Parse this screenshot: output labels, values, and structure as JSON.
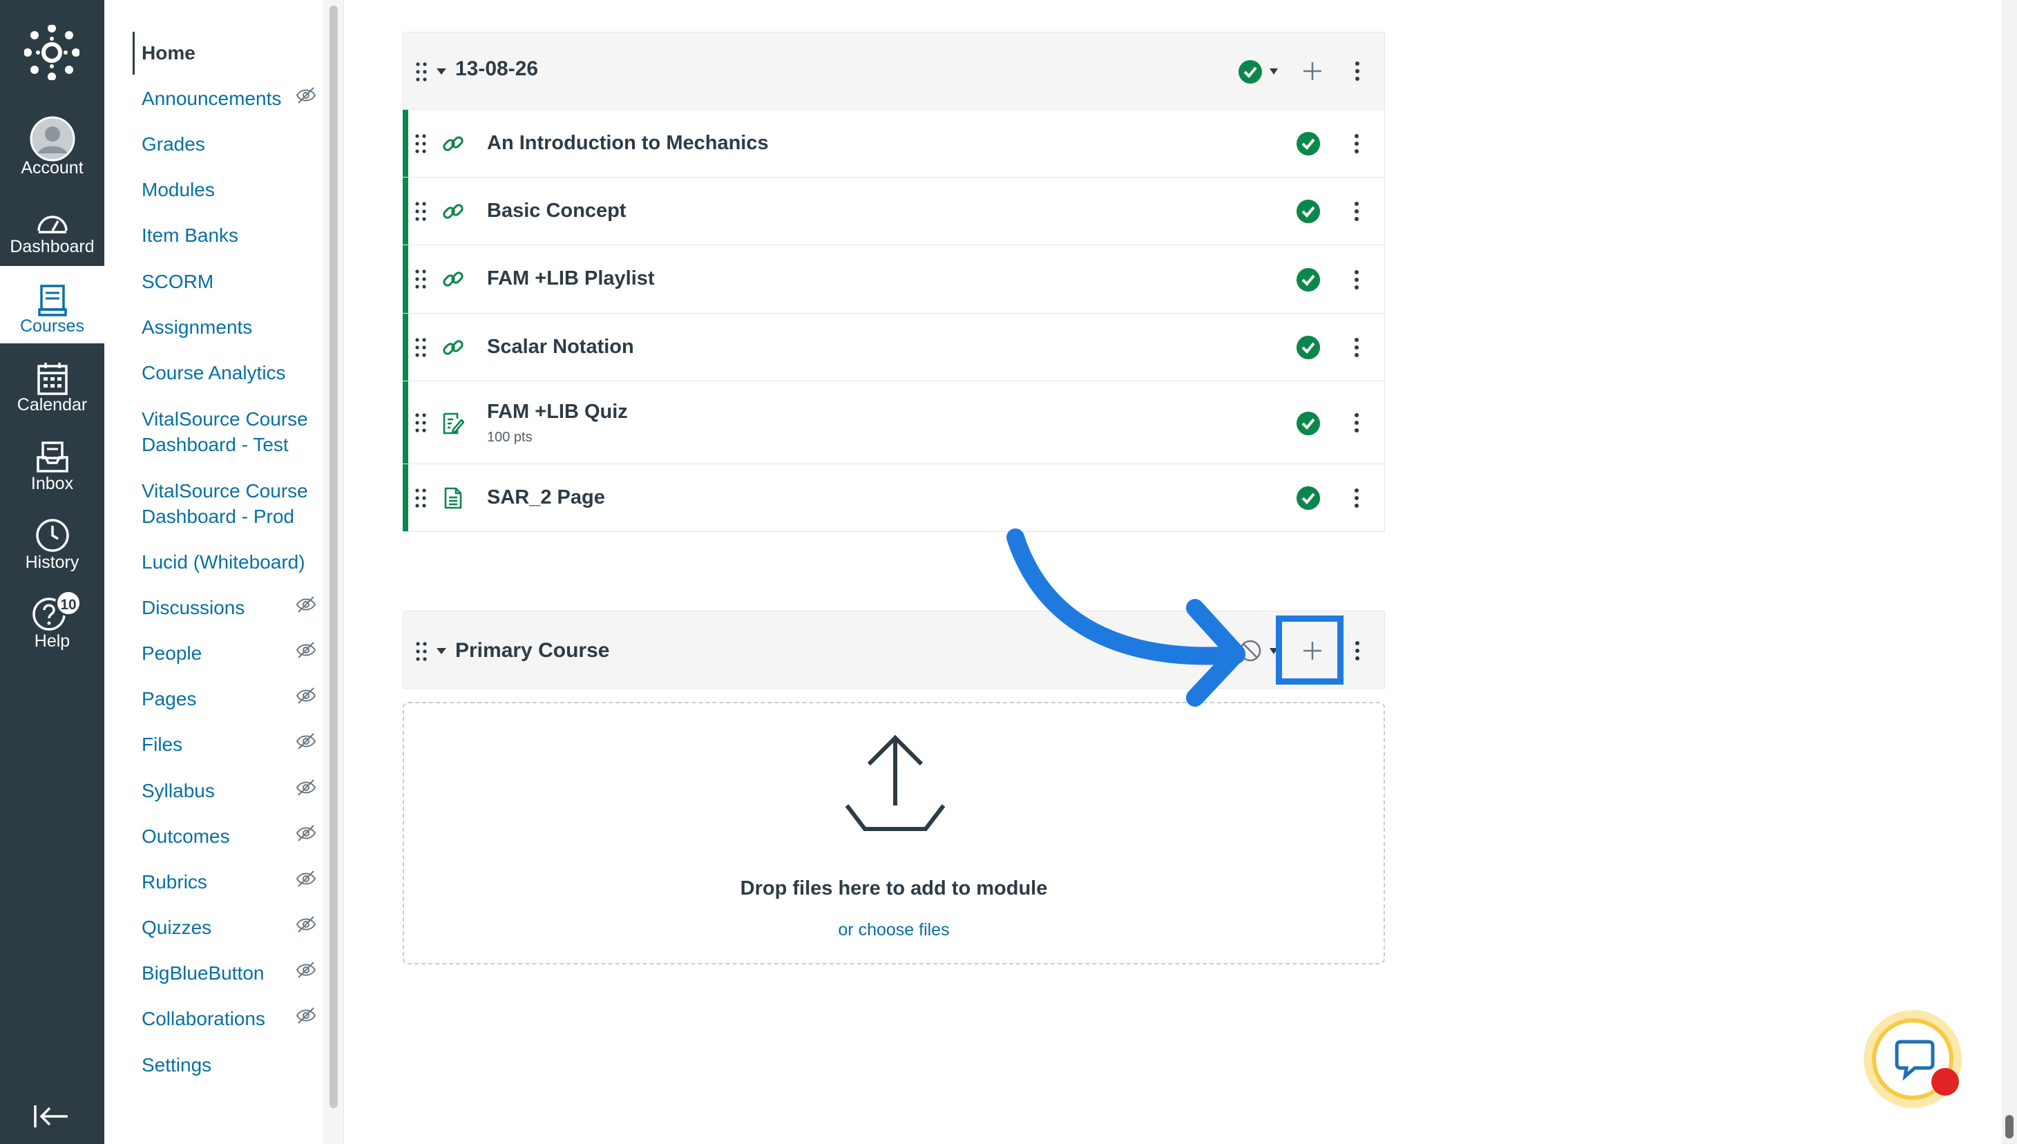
{
  "global_nav": {
    "items": [
      {
        "label": "Account",
        "icon": "account-avatar-icon"
      },
      {
        "label": "Dashboard",
        "icon": "dashboard-icon"
      },
      {
        "label": "Courses",
        "icon": "courses-icon"
      },
      {
        "label": "Calendar",
        "icon": "calendar-icon"
      },
      {
        "label": "Inbox",
        "icon": "inbox-icon"
      },
      {
        "label": "History",
        "icon": "history-icon"
      },
      {
        "label": "Help",
        "icon": "help-icon"
      }
    ],
    "help_badge": "10",
    "active": "Courses"
  },
  "course_nav": {
    "items": [
      {
        "label": "Home"
      },
      {
        "label": "Announcements"
      },
      {
        "label": "Grades"
      },
      {
        "label": "Modules"
      },
      {
        "label": "Item Banks"
      },
      {
        "label": "SCORM"
      },
      {
        "label": "Assignments"
      },
      {
        "label": "Course Analytics"
      },
      {
        "label": "VitalSource Course"
      },
      {
        "label": "Dashboard - Test"
      },
      {
        "label": "VitalSource Course"
      },
      {
        "label": "Dashboard - Prod"
      },
      {
        "label": "Lucid (Whiteboard)"
      },
      {
        "label": "Discussions"
      },
      {
        "label": "People"
      },
      {
        "label": "Pages"
      },
      {
        "label": "Files"
      },
      {
        "label": "Syllabus"
      },
      {
        "label": "Outcomes"
      },
      {
        "label": "Rubrics"
      },
      {
        "label": "Quizzes"
      },
      {
        "label": "BigBlueButton"
      },
      {
        "label": "Collaborations"
      },
      {
        "label": "Settings"
      }
    ]
  },
  "modules": [
    {
      "title": "13-08-26",
      "published": true,
      "items": [
        {
          "title": "An Introduction to Mechanics",
          "type": "link-icon",
          "published": true
        },
        {
          "title": "Basic Concept",
          "type": "link-icon",
          "published": true
        },
        {
          "title": "FAM +LIB Playlist",
          "type": "link-icon",
          "published": true
        },
        {
          "title": "Scalar Notation",
          "type": "link-icon",
          "published": true
        },
        {
          "title": "FAM +LIB Quiz",
          "type": "quiz-icon",
          "points": "100 pts",
          "published": true
        },
        {
          "title": "SAR_2 Page",
          "type": "page-icon",
          "published": true
        }
      ]
    },
    {
      "title": "Primary Course",
      "published": false,
      "items": []
    }
  ],
  "dropzone": {
    "title": "Drop files here to add to module",
    "link": "or choose files"
  },
  "colors": {
    "nav_bg": "#2d3b45",
    "link": "#0770a3",
    "published": "#0b874b",
    "annotation": "#1f7ae0"
  }
}
